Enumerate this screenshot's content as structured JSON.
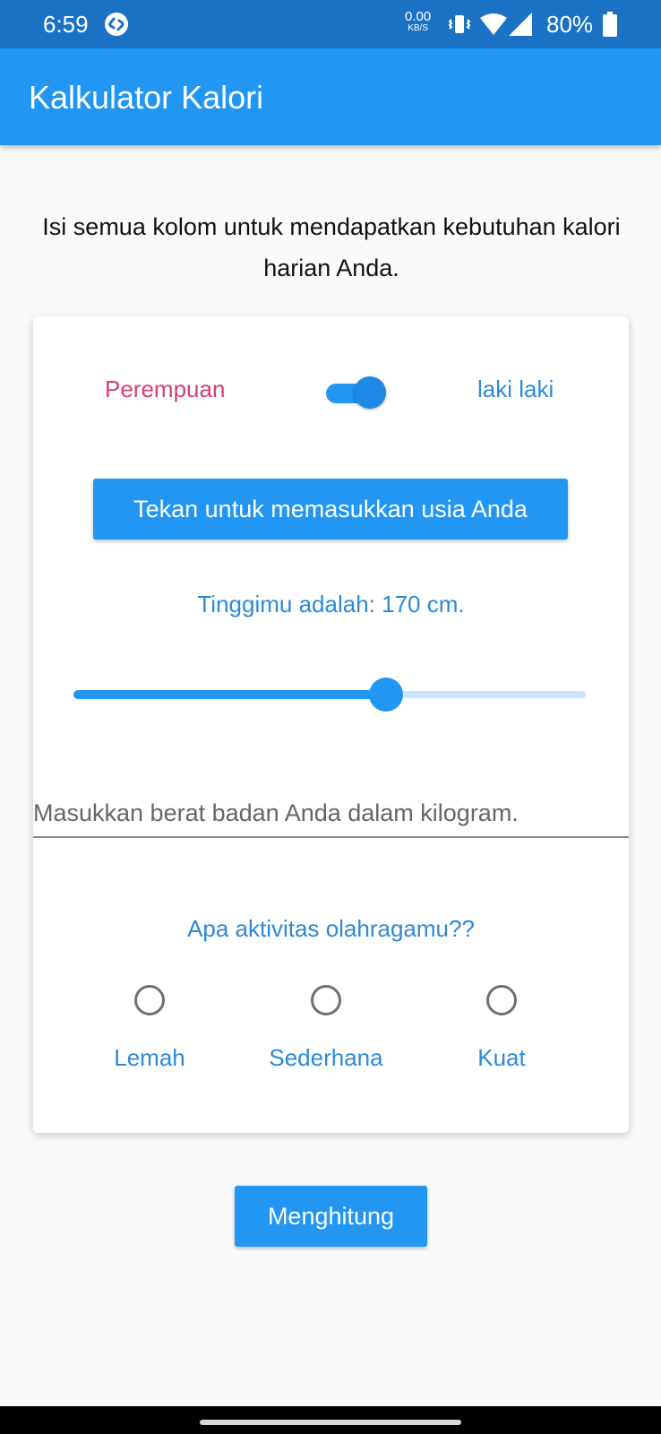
{
  "status_bar": {
    "time": "6:59",
    "net_speed_value": "0.00",
    "net_speed_unit": "KB/S",
    "battery": "80%",
    "icons": [
      "shazam-icon",
      "vibrate-icon",
      "wifi-icon",
      "signal-icon",
      "battery-icon"
    ]
  },
  "app_bar": {
    "title": "Kalkulator Kalori"
  },
  "intro": "Isi semua kolom untuk mendapatkan kebutuhan kalori harian Anda.",
  "gender": {
    "female_label": "Perempuan",
    "male_label": "laki laki",
    "switch_on": true,
    "female_color": "#d53f72",
    "male_color": "#2b8ad8"
  },
  "age_button_label": "Tekan untuk memasukkan usia Anda",
  "height": {
    "label": "Tinggimu adalah: 170 cm.",
    "slider_fraction": 0.61
  },
  "weight_placeholder": "Masukkan berat badan Anda dalam kilogram.",
  "activity": {
    "label": "Apa aktivitas olahragamu??",
    "options": [
      "Lemah",
      "Sederhana",
      "Kuat"
    ]
  },
  "calculate_label": "Menghitung",
  "colors": {
    "accent": "#2196f3",
    "status_bar": "#1b72c4"
  }
}
